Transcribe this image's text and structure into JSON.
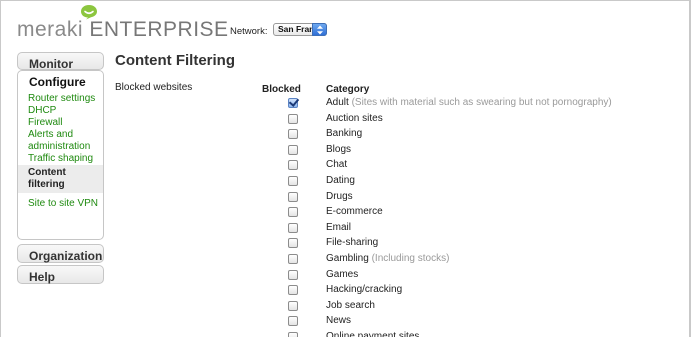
{
  "header": {
    "logo_text_primary": "meraki",
    "logo_text_secondary": "ENTERPRISE",
    "network_label": "Network:",
    "network_value": "San Francisco"
  },
  "sidebar": {
    "monitor": "Monitor",
    "configure": "Configure",
    "configure_items": [
      {
        "label": "Router settings"
      },
      {
        "label": "DHCP"
      },
      {
        "label": "Firewall"
      },
      {
        "label": "Alerts and administration"
      },
      {
        "label": "Traffic shaping"
      },
      {
        "label": "Content filtering",
        "active": true
      },
      {
        "label": "Site to site VPN"
      }
    ],
    "organization": "Organization",
    "help": "Help"
  },
  "main": {
    "title": "Content Filtering",
    "section_label": "Blocked websites",
    "columns": {
      "blocked": "Blocked",
      "category": "Category"
    },
    "categories": [
      {
        "name": "Adult",
        "note": "(Sites with material such as swearing but not pornography)",
        "blocked": true
      },
      {
        "name": "Auction sites",
        "note": "",
        "blocked": false
      },
      {
        "name": "Banking",
        "note": "",
        "blocked": false
      },
      {
        "name": "Blogs",
        "note": "",
        "blocked": false
      },
      {
        "name": "Chat",
        "note": "",
        "blocked": false
      },
      {
        "name": "Dating",
        "note": "",
        "blocked": false
      },
      {
        "name": "Drugs",
        "note": "",
        "blocked": false
      },
      {
        "name": "E-commerce",
        "note": "",
        "blocked": false
      },
      {
        "name": "Email",
        "note": "",
        "blocked": false
      },
      {
        "name": "File-sharing",
        "note": "",
        "blocked": false
      },
      {
        "name": "Gambling",
        "note": "(Including stocks)",
        "blocked": false
      },
      {
        "name": "Games",
        "note": "",
        "blocked": false
      },
      {
        "name": "Hacking/cracking",
        "note": "",
        "blocked": false
      },
      {
        "name": "Job search",
        "note": "",
        "blocked": false
      },
      {
        "name": "News",
        "note": "",
        "blocked": false
      },
      {
        "name": "Online payment sites",
        "note": "",
        "blocked": false
      }
    ]
  },
  "colors": {
    "link_green": "#1f8a10",
    "logo_badge_green": "#8cc63f",
    "muted_note": "#9a9a9a"
  },
  "icons": {
    "logo_badge": "speech-bubble-smile-icon",
    "select_arrows": "up-down-arrows-icon"
  }
}
